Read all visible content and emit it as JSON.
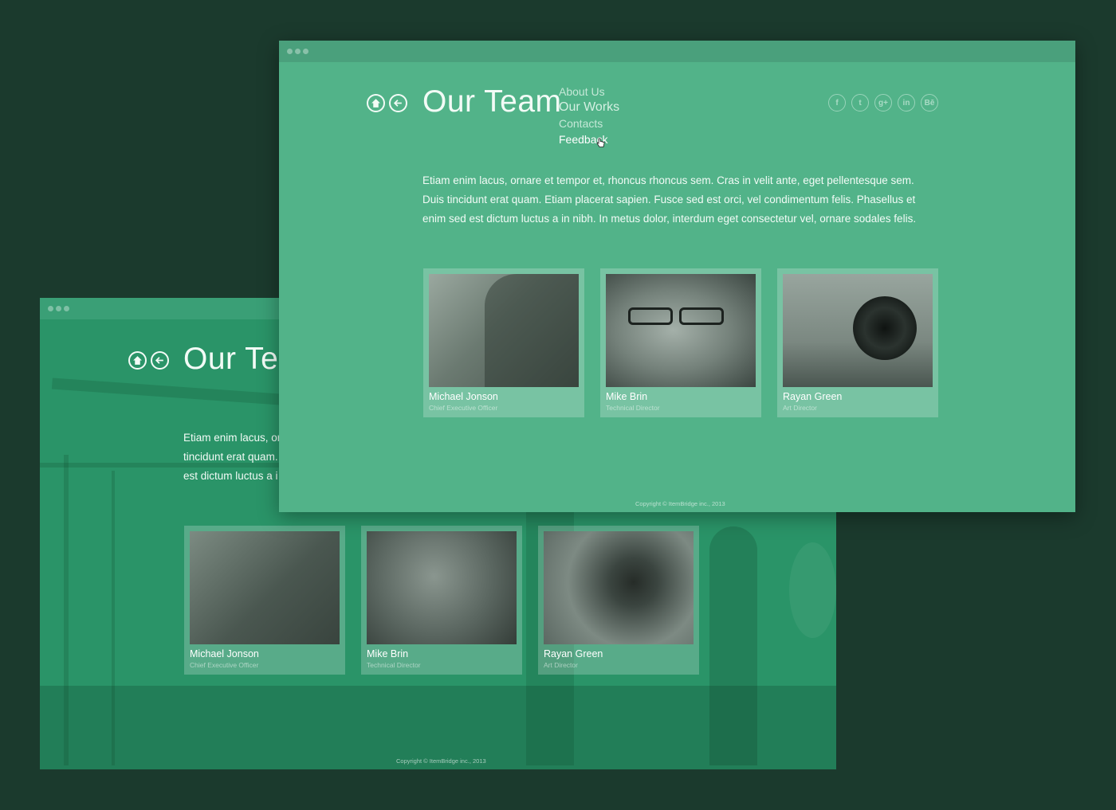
{
  "page": {
    "title": "Our Team",
    "menu": [
      "About Us",
      "Our Works",
      "Contacts",
      "Feedback"
    ],
    "intro": "Etiam enim lacus, ornare et tempor et, rhoncus rhoncus sem. Cras in velit ante, eget pellentesque sem. Duis tincidunt erat quam. Etiam placerat sapien. Fusce sed est orci, vel condimentum felis. Phasellus et enim sed est dictum luctus a in nibh. In metus dolor, interdum eget consectetur vel, ornare sodales felis.",
    "team": [
      {
        "name": "Michael Jonson",
        "role": "Chief Executive Officer"
      },
      {
        "name": "Mike Brin",
        "role": "Technical Director"
      },
      {
        "name": "Rayan Green",
        "role": "Art Director"
      }
    ],
    "copyright": "Copyright © ItemBridge inc., 2013",
    "social_icons": [
      "facebook-icon",
      "twitter-icon",
      "google-plus-icon",
      "linkedin-icon",
      "behance-icon"
    ],
    "social_glyphs": [
      "f",
      "t",
      "g+",
      "in",
      "Bē"
    ]
  },
  "back_window": {
    "title": "Our Tea",
    "intro_lines": [
      "Etiam enim lacus, or",
      "tincidunt erat quam.",
      "est dictum luctus a i"
    ]
  },
  "colors": {
    "background": "#1b3a2d",
    "front_window": "#52b389",
    "back_window": "#2a9468"
  }
}
